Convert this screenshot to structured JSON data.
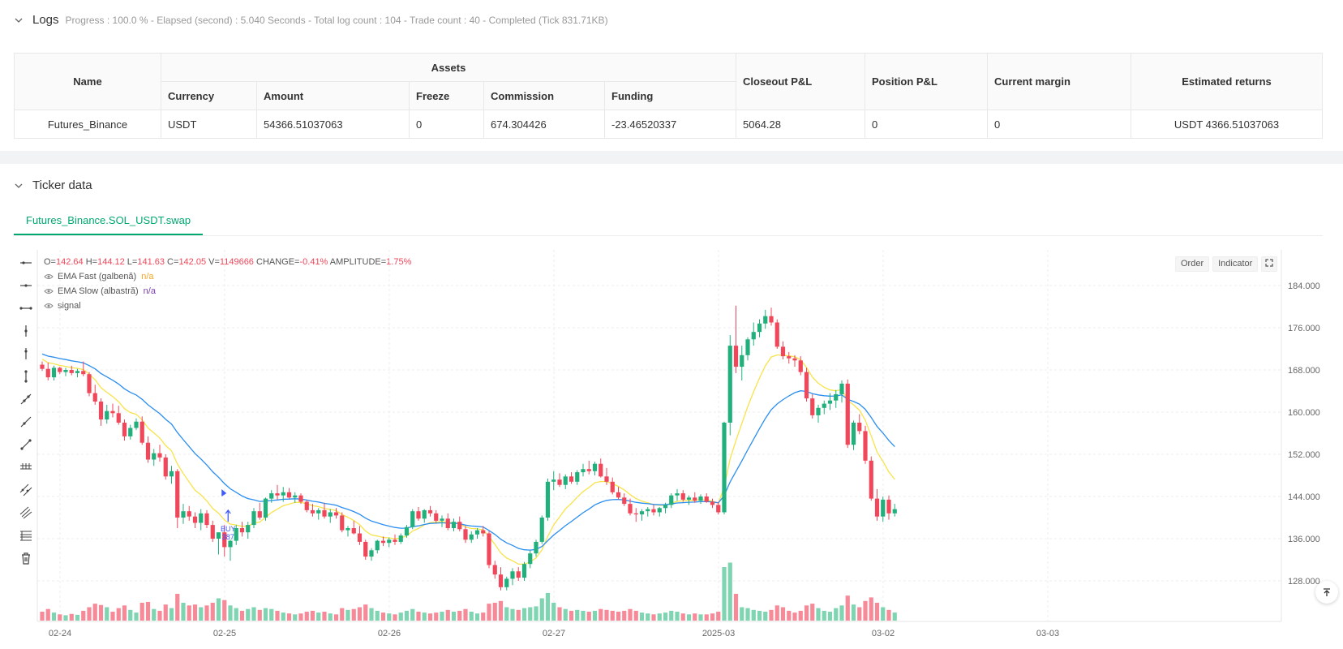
{
  "logs": {
    "title": "Logs",
    "status": "Progress : 100.0 % - Elapsed (second) : 5.040 Seconds - Total log count : 104 - Trade count : 40 - Completed (Tick 831.71KB)"
  },
  "assets_table": {
    "headers": {
      "name": "Name",
      "assets": "Assets",
      "currency": "Currency",
      "amount": "Amount",
      "freeze": "Freeze",
      "commission": "Commission",
      "funding": "Funding",
      "closeout": "Closeout P&L",
      "position": "Position P&L",
      "margin": "Current margin",
      "returns": "Estimated returns"
    },
    "row": {
      "name": "Futures_Binance",
      "currency": "USDT",
      "amount": "54366.51037063",
      "freeze": "0",
      "commission": "674.304426",
      "funding": "-23.46520337",
      "closeout": "5064.28",
      "position": "0",
      "margin": "0",
      "returns": "USDT 4366.51037063"
    }
  },
  "ticker": {
    "title": "Ticker data",
    "tab": "Futures_Binance.SOL_USDT.swap"
  },
  "chart_header": {
    "ohlc_prefix": "O=",
    "o": "142.64",
    "h_prefix": " H=",
    "h": "144.12",
    "l_prefix": " L=",
    "l": "141.63",
    "c_prefix": " C=",
    "c": "142.05",
    "v_prefix": " V=",
    "v": "1149666",
    "chg_prefix": " CHANGE=",
    "chg": "-0.41%",
    "amp_prefix": " AMPLITUDE=",
    "amp": "1.75%"
  },
  "legend": [
    {
      "label": "EMA Fast (galbenă)",
      "value": "n/a",
      "color": "#f5a623"
    },
    {
      "label": "EMA Slow (albastră)",
      "value": "n/a",
      "color": "#7b3fb5"
    },
    {
      "label": "signal",
      "value": "",
      "color": "#999999"
    }
  ],
  "chart_buttons": {
    "order": "Order",
    "indicator": "Indicator"
  },
  "colors": {
    "up": "#26a69a",
    "up_candle": "#21b07c",
    "down": "#f0475a",
    "ema_fast": "#f7e34a",
    "ema_slow": "#2a8ef0",
    "signal": "#3d5afe",
    "accent": "#00a870"
  },
  "chart_data": {
    "type": "candlestick",
    "y_ticks": [
      "128.000",
      "136.000",
      "144.000",
      "152.000",
      "160.000",
      "168.000",
      "176.000",
      "184.000"
    ],
    "ylim": [
      122,
      186
    ],
    "x_ticks": [
      "02-24",
      "02-25",
      "02-26",
      "02-27",
      "2025-03",
      "03-02",
      "03-03"
    ],
    "signal": {
      "label": "BUY",
      "qty": "387",
      "index": 29,
      "price": 142.0
    },
    "candles": [
      [
        169.0,
        169.6,
        167.8,
        168.2,
        20
      ],
      [
        168.2,
        169.4,
        166.0,
        166.6,
        26
      ],
      [
        166.6,
        168.8,
        166.0,
        168.4,
        18
      ],
      [
        168.4,
        168.6,
        167.2,
        167.6,
        14
      ],
      [
        167.6,
        168.4,
        166.8,
        168.0,
        12
      ],
      [
        168.0,
        168.8,
        167.0,
        167.4,
        15
      ],
      [
        167.4,
        168.2,
        166.6,
        167.8,
        13
      ],
      [
        167.8,
        169.6,
        166.8,
        167.2,
        22
      ],
      [
        167.2,
        167.6,
        163.0,
        163.6,
        30
      ],
      [
        163.6,
        165.2,
        161.4,
        162.0,
        38
      ],
      [
        162.0,
        162.6,
        157.4,
        158.6,
        35
      ],
      [
        158.6,
        161.4,
        157.8,
        160.2,
        30
      ],
      [
        160.2,
        161.6,
        159.0,
        159.8,
        20
      ],
      [
        159.8,
        161.2,
        157.6,
        158.0,
        28
      ],
      [
        158.0,
        158.6,
        154.6,
        155.4,
        34
      ],
      [
        155.4,
        157.6,
        154.8,
        157.0,
        24
      ],
      [
        157.0,
        158.8,
        156.6,
        158.2,
        18
      ],
      [
        158.2,
        159.2,
        153.8,
        154.2,
        40
      ],
      [
        154.2,
        155.4,
        150.4,
        151.0,
        42
      ],
      [
        151.0,
        153.0,
        149.8,
        152.2,
        26
      ],
      [
        152.2,
        153.8,
        150.6,
        151.4,
        22
      ],
      [
        151.4,
        152.0,
        147.2,
        147.8,
        36
      ],
      [
        147.8,
        149.8,
        146.4,
        148.8,
        28
      ],
      [
        148.8,
        149.2,
        138.0,
        140.0,
        60
      ],
      [
        140.0,
        142.6,
        138.8,
        141.2,
        40
      ],
      [
        141.2,
        142.2,
        139.4,
        140.2,
        34
      ],
      [
        140.2,
        141.0,
        138.0,
        139.0,
        36
      ],
      [
        139.0,
        141.6,
        137.6,
        140.8,
        30
      ],
      [
        140.8,
        141.4,
        138.0,
        138.6,
        34
      ],
      [
        138.6,
        139.4,
        135.4,
        136.0,
        40
      ],
      [
        136.0,
        137.2,
        133.0,
        137.2,
        50
      ],
      [
        137.2,
        138.6,
        132.6,
        134.4,
        46
      ],
      [
        134.4,
        135.8,
        131.8,
        135.6,
        34
      ],
      [
        135.6,
        138.6,
        134.8,
        138.0,
        28
      ],
      [
        138.0,
        139.2,
        136.4,
        137.2,
        22
      ],
      [
        137.2,
        139.2,
        136.0,
        138.6,
        26
      ],
      [
        138.6,
        141.8,
        138.0,
        141.2,
        30
      ],
      [
        141.2,
        142.8,
        139.6,
        140.0,
        24
      ],
      [
        140.0,
        143.8,
        139.4,
        143.6,
        28
      ],
      [
        143.6,
        145.2,
        142.8,
        144.6,
        26
      ],
      [
        144.6,
        146.2,
        143.4,
        144.2,
        22
      ],
      [
        144.2,
        145.8,
        143.0,
        144.8,
        18
      ],
      [
        144.8,
        145.6,
        143.6,
        143.8,
        16
      ],
      [
        143.8,
        144.8,
        142.8,
        144.2,
        14
      ],
      [
        144.2,
        144.6,
        142.6,
        143.0,
        16
      ],
      [
        143.0,
        143.4,
        141.0,
        141.4,
        20
      ],
      [
        141.4,
        142.6,
        140.2,
        140.8,
        22
      ],
      [
        140.8,
        141.8,
        139.6,
        141.4,
        18
      ],
      [
        141.4,
        142.8,
        139.8,
        140.2,
        20
      ],
      [
        140.2,
        141.6,
        139.0,
        141.0,
        16
      ],
      [
        141.0,
        141.8,
        139.8,
        140.4,
        14
      ],
      [
        140.4,
        141.0,
        137.2,
        137.6,
        28
      ],
      [
        137.6,
        138.4,
        136.4,
        138.0,
        24
      ],
      [
        138.0,
        139.4,
        136.8,
        137.0,
        26
      ],
      [
        137.0,
        138.4,
        134.8,
        135.4,
        30
      ],
      [
        135.4,
        135.8,
        132.0,
        132.6,
        36
      ],
      [
        132.6,
        134.2,
        131.8,
        133.8,
        28
      ],
      [
        133.8,
        135.8,
        133.2,
        135.6,
        22
      ],
      [
        135.6,
        136.4,
        134.6,
        135.2,
        18
      ],
      [
        135.2,
        136.2,
        134.4,
        135.8,
        16
      ],
      [
        135.8,
        136.8,
        134.8,
        135.4,
        14
      ],
      [
        135.4,
        137.0,
        135.0,
        136.6,
        18
      ],
      [
        136.6,
        138.6,
        136.2,
        138.2,
        22
      ],
      [
        138.2,
        141.6,
        137.8,
        141.2,
        26
      ],
      [
        141.2,
        142.0,
        139.4,
        139.8,
        20
      ],
      [
        139.8,
        141.6,
        139.0,
        141.4,
        18
      ],
      [
        141.4,
        142.2,
        140.2,
        140.8,
        16
      ],
      [
        140.8,
        141.4,
        139.0,
        139.4,
        18
      ],
      [
        139.4,
        140.4,
        138.2,
        139.8,
        20
      ],
      [
        139.8,
        140.8,
        137.6,
        138.0,
        24
      ],
      [
        138.0,
        139.8,
        137.4,
        139.2,
        20
      ],
      [
        139.2,
        140.2,
        137.4,
        137.8,
        22
      ],
      [
        137.8,
        138.4,
        135.2,
        135.8,
        26
      ],
      [
        135.8,
        137.4,
        135.2,
        136.8,
        20
      ],
      [
        136.8,
        138.0,
        136.0,
        137.6,
        16
      ],
      [
        137.6,
        138.4,
        136.4,
        137.0,
        18
      ],
      [
        137.0,
        137.4,
        130.4,
        131.0,
        38
      ],
      [
        131.0,
        131.8,
        128.4,
        129.2,
        40
      ],
      [
        129.2,
        130.6,
        126.2,
        126.8,
        44
      ],
      [
        126.8,
        128.8,
        126.2,
        128.4,
        30
      ],
      [
        128.4,
        130.4,
        127.2,
        129.8,
        26
      ],
      [
        129.8,
        130.6,
        128.0,
        128.6,
        24
      ],
      [
        128.6,
        131.6,
        128.0,
        131.2,
        28
      ],
      [
        131.2,
        133.8,
        130.4,
        133.2,
        30
      ],
      [
        133.2,
        135.8,
        132.6,
        135.4,
        32
      ],
      [
        135.4,
        140.4,
        135.0,
        140.0,
        50
      ],
      [
        140.0,
        147.4,
        139.4,
        146.8,
        62
      ],
      [
        146.8,
        148.8,
        145.2,
        147.2,
        40
      ],
      [
        147.2,
        148.4,
        145.8,
        146.2,
        30
      ],
      [
        146.2,
        148.2,
        145.4,
        147.8,
        26
      ],
      [
        147.8,
        148.6,
        146.4,
        146.8,
        22
      ],
      [
        146.8,
        149.0,
        146.2,
        148.6,
        24
      ],
      [
        148.6,
        150.2,
        147.8,
        149.2,
        22
      ],
      [
        149.2,
        150.8,
        148.2,
        148.8,
        20
      ],
      [
        148.8,
        150.6,
        148.0,
        150.2,
        22
      ],
      [
        150.2,
        151.2,
        147.6,
        147.8,
        26
      ],
      [
        147.8,
        149.4,
        146.2,
        146.8,
        24
      ],
      [
        146.8,
        147.6,
        144.4,
        144.8,
        22
      ],
      [
        144.8,
        145.8,
        143.4,
        143.8,
        20
      ],
      [
        143.8,
        144.6,
        142.2,
        142.6,
        22
      ],
      [
        142.6,
        143.6,
        140.4,
        140.8,
        26
      ],
      [
        140.8,
        141.8,
        139.2,
        140.6,
        22
      ],
      [
        140.6,
        141.6,
        139.4,
        141.2,
        18
      ],
      [
        141.2,
        142.0,
        140.2,
        141.6,
        16
      ],
      [
        141.6,
        142.4,
        140.4,
        141.0,
        14
      ],
      [
        141.0,
        142.0,
        140.2,
        141.8,
        16
      ],
      [
        141.8,
        142.8,
        140.8,
        142.4,
        18
      ],
      [
        142.4,
        144.6,
        141.8,
        144.2,
        22
      ],
      [
        144.2,
        145.4,
        143.2,
        144.6,
        20
      ],
      [
        144.6,
        145.2,
        143.0,
        143.4,
        16
      ],
      [
        143.4,
        144.2,
        142.4,
        143.8,
        14
      ],
      [
        143.8,
        144.8,
        142.8,
        143.2,
        16
      ],
      [
        143.2,
        144.4,
        142.6,
        144.0,
        14
      ],
      [
        144.0,
        144.6,
        142.8,
        143.0,
        14
      ],
      [
        143.0,
        143.6,
        141.8,
        142.4,
        16
      ],
      [
        142.4,
        143.0,
        140.6,
        141.0,
        20
      ],
      [
        141.0,
        158.2,
        140.6,
        158.0,
        120
      ],
      [
        158.0,
        174.6,
        155.6,
        172.6,
        130
      ],
      [
        172.6,
        180.2,
        167.4,
        168.6,
        60
      ],
      [
        168.6,
        172.6,
        166.0,
        170.8,
        30
      ],
      [
        170.8,
        174.2,
        169.8,
        173.8,
        28
      ],
      [
        173.8,
        177.0,
        172.6,
        175.2,
        24
      ],
      [
        175.2,
        177.6,
        174.2,
        176.8,
        22
      ],
      [
        176.8,
        179.4,
        175.8,
        178.2,
        20
      ],
      [
        178.2,
        179.8,
        176.4,
        177.0,
        24
      ],
      [
        177.0,
        177.6,
        172.0,
        172.4,
        34
      ],
      [
        172.4,
        173.4,
        170.0,
        170.6,
        30
      ],
      [
        170.6,
        171.4,
        169.2,
        170.2,
        22
      ],
      [
        170.2,
        170.8,
        168.6,
        169.8,
        18
      ],
      [
        169.8,
        170.6,
        167.0,
        167.6,
        22
      ],
      [
        167.6,
        168.4,
        162.0,
        162.6,
        34
      ],
      [
        162.6,
        163.4,
        158.8,
        159.4,
        38
      ],
      [
        159.4,
        161.4,
        158.0,
        160.8,
        28
      ],
      [
        160.8,
        162.2,
        159.6,
        161.6,
        22
      ],
      [
        161.6,
        163.6,
        160.4,
        162.2,
        20
      ],
      [
        162.2,
        164.2,
        160.8,
        163.4,
        28
      ],
      [
        163.4,
        166.0,
        161.8,
        165.4,
        34
      ],
      [
        165.4,
        166.2,
        153.2,
        153.8,
        56
      ],
      [
        153.8,
        158.4,
        152.8,
        158.0,
        36
      ],
      [
        158.0,
        159.6,
        155.8,
        156.4,
        30
      ],
      [
        156.4,
        157.4,
        150.2,
        150.8,
        44
      ],
      [
        150.8,
        151.6,
        143.2,
        143.6,
        52
      ],
      [
        143.6,
        145.4,
        139.4,
        140.2,
        40
      ],
      [
        140.2,
        144.0,
        139.2,
        143.4,
        30
      ],
      [
        143.4,
        144.2,
        139.6,
        140.8,
        24
      ],
      [
        140.8,
        142.6,
        140.2,
        141.6,
        18
      ]
    ]
  }
}
